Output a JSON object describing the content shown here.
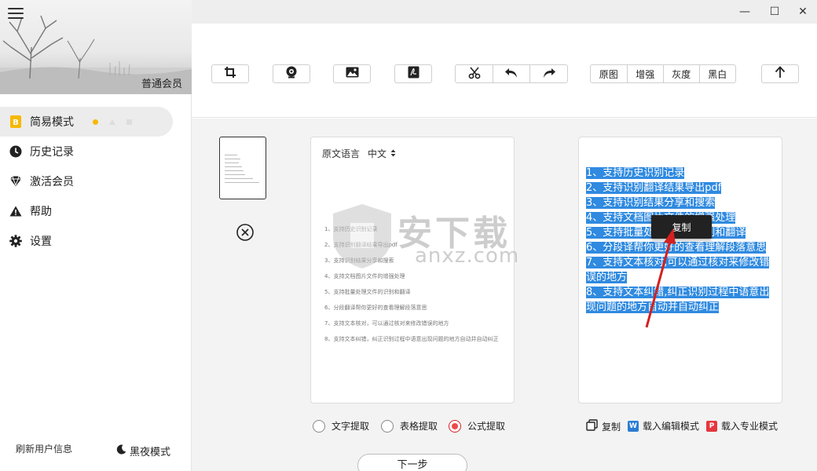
{
  "sidebar": {
    "member_label": "普通会员",
    "items": [
      {
        "label": "简易模式",
        "icon": "b-badge-icon"
      },
      {
        "label": "历史记录",
        "icon": "clock-icon"
      },
      {
        "label": "激活会员",
        "icon": "diamond-icon"
      },
      {
        "label": "帮助",
        "icon": "warning-icon"
      },
      {
        "label": "设置",
        "icon": "gear-icon"
      }
    ],
    "refresh_user": "刷新用户信息",
    "night_mode": "黑夜模式"
  },
  "window": {
    "minimize": "—",
    "maximize": "☐",
    "close": "✕"
  },
  "toolbar": {
    "filters": [
      "原图",
      "增强",
      "灰度",
      "黑白"
    ]
  },
  "original": {
    "lang_label": "原文语言",
    "lang_value": "中文",
    "lines": [
      "1、支持历史识别记录",
      "2、支持识别翻译结果导出pdf",
      "3、支持识别结果分享和搜索",
      "4、支持文档图片文件的增强处理",
      "5、支持批量处理文件的识别和翻译",
      "6、分段翻译帮你更好的查看理解段落意思",
      "7、支持文本核对，可以通过核对来修改错误的地方",
      "8、支持文本纠错，纠正识别过程中语意出现问题的地方自动并自动纠正"
    ]
  },
  "result": {
    "lines": [
      "1、支持历史识别记录",
      "2、支持识别翻译结果导出pdf",
      "3、支持识别结果分享和搜索",
      "4、支持文档图片文件的增强处理",
      "5、支持批量处理文件的识别和翻译",
      "6、分段译帮你更好的查看理解段落意思",
      "7、支持文本核对,可以通过核对来修改错误的地方",
      "8、支持文本纠错,纠正识别过程中语意出现问题的地方自动并自动纠正"
    ],
    "context_copy": "复制"
  },
  "watermark": {
    "text": "安下载",
    "sub": "anxz.com"
  },
  "modes": [
    {
      "label": "文字提取",
      "selected": false
    },
    {
      "label": "表格提取",
      "selected": false
    },
    {
      "label": "公式提取",
      "selected": true
    }
  ],
  "actions": {
    "copy": "复制",
    "word_badge": "W",
    "word": "载入编辑模式",
    "pdf_badge": "P",
    "pdf": "载入专业模式"
  },
  "next_button": "下一步",
  "colors": {
    "accent_yellow": "#f6b800",
    "highlight_blue": "#2f8ae0",
    "radio_red": "#ec4a4a",
    "word_blue": "#2b7cd3",
    "pdf_red": "#e5373f"
  }
}
